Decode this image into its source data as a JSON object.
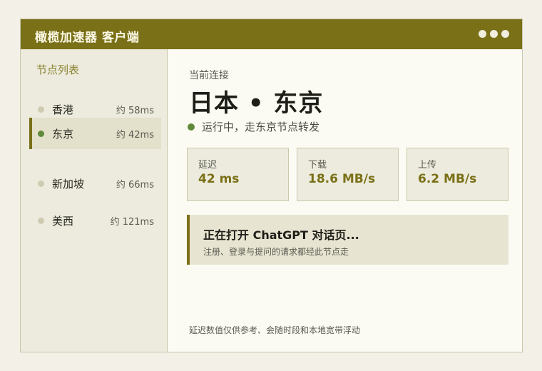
{
  "window": {
    "title": "橄榄加速器  客户端"
  },
  "sidebar": {
    "heading": "节点列表",
    "nodes": [
      {
        "name": "香港",
        "latency": "约 58ms",
        "active": false
      },
      {
        "name": "东京",
        "latency": "约 42ms",
        "active": true
      },
      {
        "name": "新加坡",
        "latency": "约 66ms",
        "active": false
      },
      {
        "name": "美西",
        "latency": "约 121ms",
        "active": false
      }
    ]
  },
  "main": {
    "current_label": "当前连接",
    "current_name": "日本 • 东京",
    "status_text": "运行中，走东京节点转发",
    "stats": [
      {
        "label": "延迟",
        "value": "42 ms"
      },
      {
        "label": "下载",
        "value": "18.6 MB/s"
      },
      {
        "label": "上传",
        "value": "6.2 MB/s"
      }
    ],
    "banner": {
      "title": "正在打开 ChatGPT 对话页...",
      "subtitle": "注册、登录与提问的请求都经此节点走"
    },
    "footnote": "延迟数值仅供参考、会随时段和本地宽带浮动"
  },
  "colors": {
    "accent": "#7a7017",
    "status_green": "#5f8a3a",
    "sidebar_bg": "#ecebdd",
    "content_bg": "#fcfbf3"
  }
}
